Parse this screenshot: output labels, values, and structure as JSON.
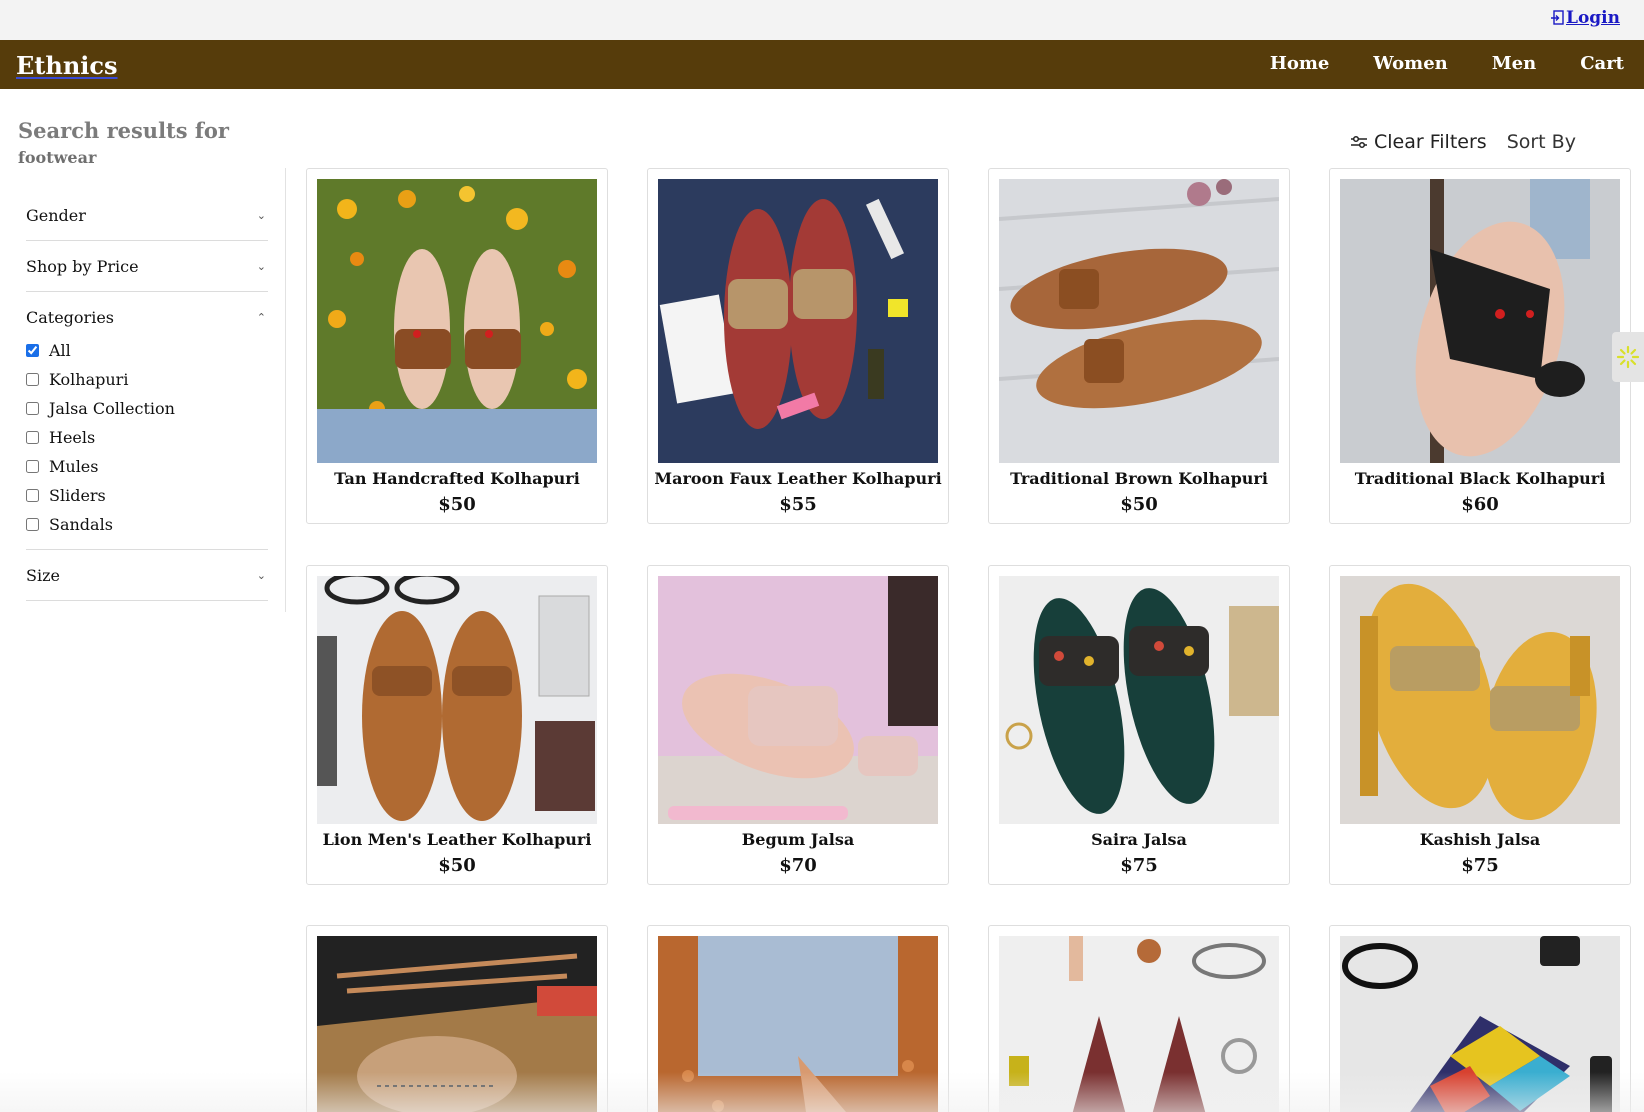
{
  "header": {
    "login_label": "Login",
    "brand": "Ethnics",
    "nav": [
      "Home",
      "Women",
      "Men",
      "Cart"
    ]
  },
  "search": {
    "title": "Search results for",
    "term": "footwear"
  },
  "filters": {
    "gender": "Gender",
    "price": "Shop by Price",
    "categories": "Categories",
    "category_items": [
      {
        "label": "All",
        "checked": true
      },
      {
        "label": "Kolhapuri",
        "checked": false
      },
      {
        "label": "Jalsa Collection",
        "checked": false
      },
      {
        "label": "Heels",
        "checked": false
      },
      {
        "label": "Mules",
        "checked": false
      },
      {
        "label": "Sliders",
        "checked": false
      },
      {
        "label": "Sandals",
        "checked": false
      }
    ],
    "size": "Size"
  },
  "toolbar": {
    "clear_filters": "Clear Filters",
    "sort_by": "Sort By"
  },
  "products": [
    {
      "name": "Tan Handcrafted Kolhapuri",
      "price": "$50"
    },
    {
      "name": "Maroon Faux Leather Kolhapuri",
      "price": "$55"
    },
    {
      "name": "Traditional Brown Kolhapuri",
      "price": "$50"
    },
    {
      "name": "Traditional Black Kolhapuri",
      "price": "$60"
    },
    {
      "name": "Lion Men's Leather Kolhapuri",
      "price": "$50"
    },
    {
      "name": "Begum Jalsa",
      "price": "$70"
    },
    {
      "name": "Saira Jalsa",
      "price": "$75"
    },
    {
      "name": "Kashish Jalsa",
      "price": "$75"
    },
    {
      "name": "",
      "price": ""
    },
    {
      "name": "",
      "price": ""
    },
    {
      "name": "",
      "price": ""
    },
    {
      "name": "",
      "price": ""
    }
  ],
  "colors": {
    "navbar": "#563c0b",
    "link": "#1a19c4",
    "checkbox": "#1a6fe8"
  }
}
